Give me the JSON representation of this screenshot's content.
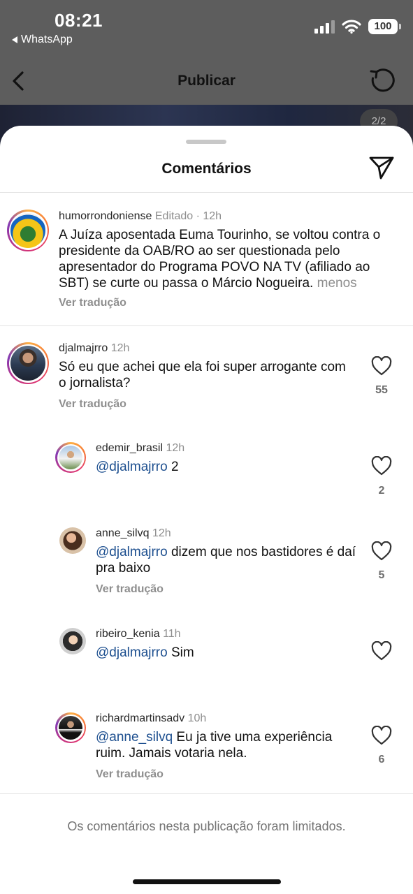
{
  "status_bar": {
    "time": "08:21",
    "back_app": "WhatsApp",
    "battery": "100"
  },
  "nav": {
    "title": "Publicar"
  },
  "post": {
    "page_indicator": "2/2"
  },
  "sheet": {
    "title": "Comentários",
    "footer_note": "Os comentários nesta publicação foram limitados."
  },
  "caption": {
    "username": "humorrondoniense",
    "edited": "Editado",
    "time": "12h",
    "text": "A Juíza aposentada Euma Tourinho, se voltou contra o presidente da OAB/RO ao ser questionada pelo apresentador do Programa POVO NA TV (afiliado ao SBT) se curte ou passa o Márcio Nogueira.",
    "less": "menos",
    "translate": "Ver tradução"
  },
  "comments": [
    {
      "username": "djalmajrro",
      "time": "12h",
      "mention": "",
      "text": "Só eu que achei que ela foi super arrogante com o jornalista?",
      "translate": "Ver tradução",
      "likes": "55"
    },
    {
      "username": "edemir_brasil",
      "time": "12h",
      "mention": "@djalmajrro",
      "text": "2",
      "translate": "",
      "likes": "2"
    },
    {
      "username": "anne_silvq",
      "time": "12h",
      "mention": "@djalmajrro",
      "text": "dizem que nos bastidores é daí pra baixo",
      "translate": "Ver tradução",
      "likes": "5"
    },
    {
      "username": "ribeiro_kenia",
      "time": "11h",
      "mention": "@djalmajrro",
      "text": "Sim",
      "translate": "",
      "likes": ""
    },
    {
      "username": "richardmartinsadv",
      "time": "10h",
      "mention": "@anne_silvq",
      "text": "Eu ja tive uma experiência ruim. Jamais votaria nela.",
      "translate": "Ver tradução",
      "likes": "6"
    }
  ],
  "colors": {
    "mention": "#1d4f8f",
    "meta": "#8e8e8e",
    "sheet_bg": "#ffffff"
  },
  "icons": [
    "chevron-left-icon",
    "refresh-icon",
    "send-icon",
    "heart-icon"
  ]
}
